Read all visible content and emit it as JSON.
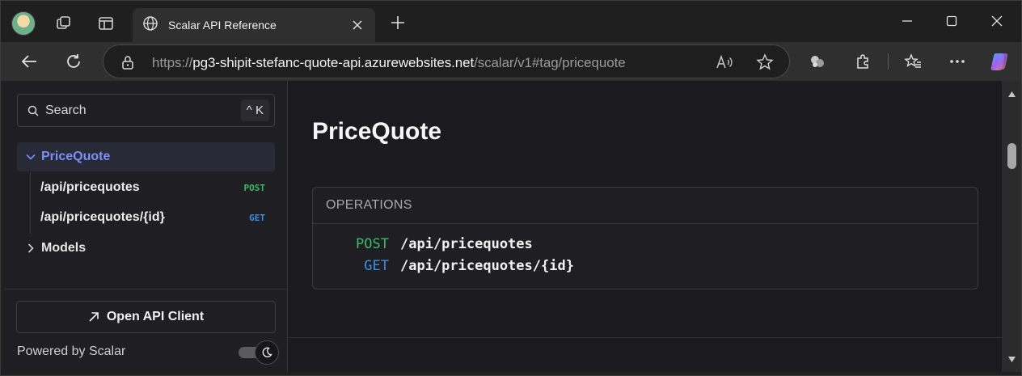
{
  "browser": {
    "tab_title": "Scalar API Reference",
    "url_prefix": "https://",
    "url_host": "pg3-shipit-stefanc-quote-api.azurewebsites.net",
    "url_path": "/scalar/v1#tag/pricequote",
    "icons": [
      "profile-avatar",
      "workspaces-icon",
      "tab-actions-icon",
      "globe-icon",
      "close-icon",
      "plus-icon",
      "minimize-icon",
      "maximize-icon",
      "window-close-icon",
      "back-icon",
      "refresh-icon",
      "lock-icon",
      "read-aloud-icon",
      "favorite-star-icon",
      "extensions-icon",
      "puzzle-icon",
      "favorites-icon",
      "more-icon",
      "copilot-icon"
    ]
  },
  "sidebar": {
    "search_label": "Search",
    "search_shortcut": "^ K",
    "items": [
      {
        "label": "PriceQuote",
        "expanded": true,
        "active": true
      },
      {
        "label": "Models",
        "expanded": false,
        "active": false
      }
    ],
    "operations": [
      {
        "path": "/api/pricequotes",
        "method": "POST"
      },
      {
        "path": "/api/pricequotes/{id}",
        "method": "GET"
      }
    ],
    "open_client_label": "Open API Client",
    "powered_by": "Powered by Scalar"
  },
  "main": {
    "title": "PriceQuote",
    "operations_header": "OPERATIONS",
    "operations": [
      {
        "method": "POST",
        "path": "/api/pricequotes"
      },
      {
        "method": "GET",
        "path": "/api/pricequotes/{id}"
      }
    ]
  },
  "colors": {
    "accent": "#7b8ff5",
    "post": "#3db96a",
    "get": "#3d8fe0",
    "background": "#1b1b1f"
  }
}
